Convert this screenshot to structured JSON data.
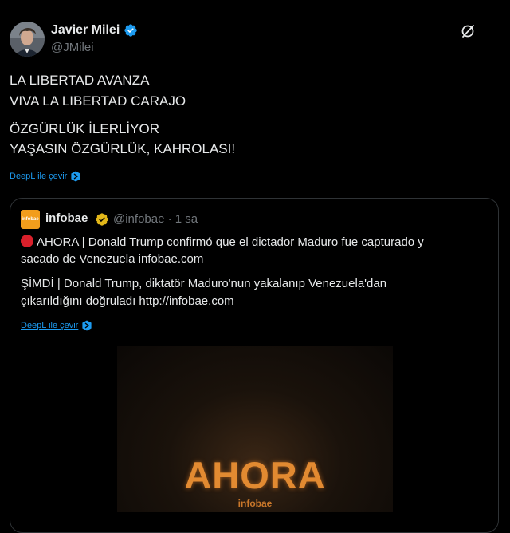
{
  "author": {
    "display_name": "Javier Milei",
    "handle": "@JMilei",
    "avatar_icon": "profile-photo",
    "verified_icon": "verified-badge-icon"
  },
  "tweet": {
    "lines": [
      "LA LIBERTAD AVANZA",
      "VIVA LA LIBERTAD CARAJO",
      "ÖZGÜRLÜK İLERLİYOR",
      "YAŞASIN ÖZGÜRLÜK, KAHROLASI!"
    ],
    "translate_label": "DeepL ile çevir"
  },
  "quote": {
    "logo_text": "infobae",
    "name": "infobae",
    "handle_time": "@infobae · 1 sa",
    "lines": [
      "AHORA | Donald Trump confirmó que el dictador Maduro fue capturado y",
      "sacado de Venezuela infobae.com",
      "ŞİMDİ | Donald Trump, diktatör Maduro'nun yakalanıp Venezuela'dan",
      "çıkarıldığını doğruladı http://infobae.com"
    ],
    "translate_label": "DeepL ile çevir",
    "media": {
      "headline": "AHORA",
      "brand": "infobae"
    }
  },
  "colors": {
    "background": "#000000",
    "text": "#e7e9ea",
    "muted": "#71767b",
    "link": "#1d9bf0",
    "verified_blue": "#1d9bf0",
    "verified_gold": "#e2b719",
    "infobae_orange": "#f29d1c",
    "alert_red": "#d9202b"
  }
}
